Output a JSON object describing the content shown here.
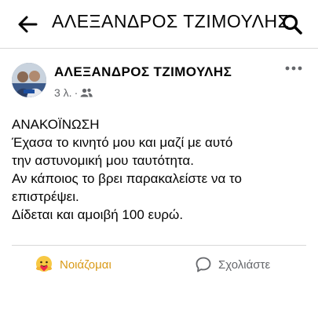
{
  "topbar": {
    "title": "ΑΛΕΞΑΝΔΡΟΣ ΤΖΙΜΟΥΛΗΣ",
    "back_icon": "arrow-left-icon",
    "search_icon": "search-icon"
  },
  "post": {
    "author": "ΑΛΕΞΑΝΔΡΟΣ ΤΖΙΜΟΥΛΗΣ",
    "time": "3 λ.",
    "separator": "·",
    "audience_icon": "friends-icon",
    "more_icon": "more-dots-icon",
    "body_lines": [
      "ΑΝΑΚΟΪΝΩΣΗ",
      "Έχασα το κινητό μου και μαζί με αυτό",
      "την αστυνομική μου ταυτότητα.",
      "Αν κάποιος το βρει παρακαλείστε να το",
      "επιστρέψει.",
      "Δίδεται και αμοιβή 100 ευρώ."
    ]
  },
  "actions": {
    "reaction_label": "Νοιάζομαι",
    "reaction_icon": "care-emoji-icon",
    "reaction_color": "#d99a17",
    "comment_label": "Σχολιάστε",
    "comment_icon": "comment-icon"
  }
}
